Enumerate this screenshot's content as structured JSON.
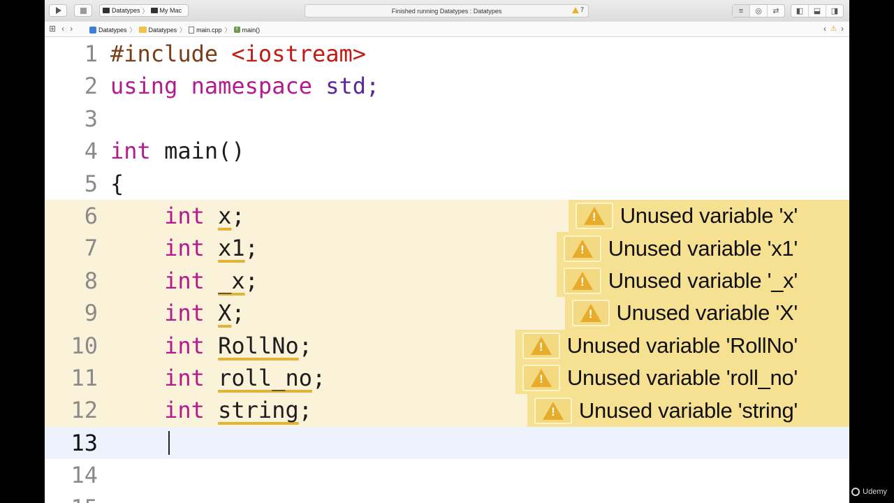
{
  "toolbar": {
    "scheme_target": "Datatypes",
    "scheme_device": "My Mac",
    "activity_status": "Finished running Datatypes : Datatypes",
    "warning_count": "7"
  },
  "jump_bar": {
    "crumbs": [
      "Datatypes",
      "Datatypes",
      "main.cpp",
      "main()"
    ],
    "issue_marker": "⚠"
  },
  "editor": {
    "line_numbers": [
      "1",
      "2",
      "3",
      "4",
      "5",
      "6",
      "7",
      "8",
      "9",
      "10",
      "11",
      "12",
      "13",
      "14",
      "15"
    ],
    "code": {
      "include_directive": "#include",
      "include_header": "<iostream>",
      "using_kw": "using",
      "namespace_kw": "namespace",
      "std_text": "std;",
      "int_kw": "int",
      "main_sig": "main()",
      "open_brace": "{",
      "variables": [
        "x",
        "x1",
        "_x",
        "X",
        "RollNo",
        "roll_no",
        "string"
      ],
      "semicolon": ";"
    },
    "warnings": [
      "Unused variable 'x'",
      "Unused variable 'x1'",
      "Unused variable '_x'",
      "Unused variable 'X'",
      "Unused variable 'RollNo'",
      "Unused variable 'roll_no'",
      "Unused variable 'string'"
    ]
  },
  "watermark": "Udemy",
  "colors": {
    "keyword": "#b21a8e",
    "preprocessor": "#7a3d17",
    "string": "#c41a16",
    "warning_line": "#fbf3d9",
    "warning_badge": "#f6e092",
    "current_line": "#ecf3fc"
  }
}
